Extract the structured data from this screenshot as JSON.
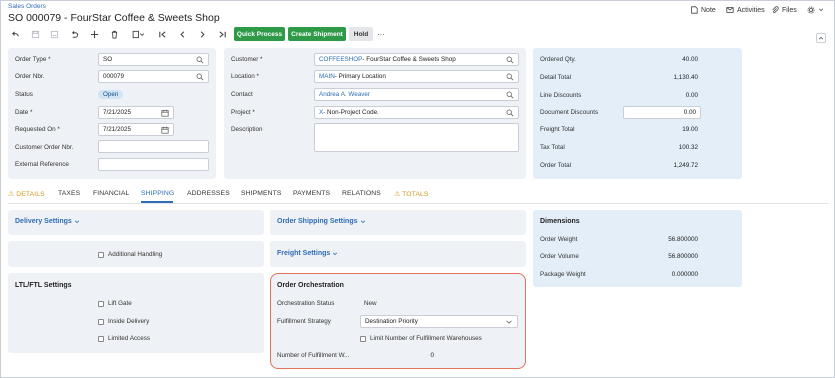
{
  "header": {
    "breadcrumb": "Sales Orders",
    "title": "SO 000079 - FourStar Coffee & Sweets Shop",
    "note_label": "Note",
    "activities_label": "Activities",
    "files_label": "Files"
  },
  "toolbar": {
    "quick_process": "Quick Process",
    "create_shipment": "Create Shipment",
    "hold": "Hold",
    "more": "···",
    "colors": {
      "green": "#2e9a47"
    }
  },
  "left_form": {
    "order_type_label": "Order Type *",
    "order_type_value": "SO",
    "order_nbr_label": "Order Nbr.",
    "order_nbr_value": "000079",
    "status_label": "Status",
    "status_value": "Open",
    "date_label": "Date *",
    "date_value": "7/21/2025",
    "requested_on_label": "Requested On *",
    "requested_on_value": "7/21/2025",
    "customer_order_label": "Customer Order Nbr.",
    "customer_order_value": "",
    "external_ref_label": "External Reference",
    "external_ref_value": ""
  },
  "mid_form": {
    "customer_label": "Customer *",
    "customer_code": "COFFEESHOP",
    "customer_name": " - FourStar Coffee & Sweets Shop",
    "location_label": "Location *",
    "location_code": "MAIN",
    "location_name": " - Primary Location",
    "contact_label": "Contact",
    "contact_value": "Andrea A. Weaver",
    "project_label": "Project *",
    "project_code": "X",
    "project_name": " - Non-Project Code.",
    "description_label": "Description",
    "description_value": ""
  },
  "totals": {
    "ordered_qty_label": "Ordered Qty.",
    "ordered_qty": "40.00",
    "detail_total_label": "Detail Total",
    "detail_total": "1,130.40",
    "line_discounts_label": "Line Discounts",
    "line_discounts": "0.00",
    "document_discounts_label": "Document Discounts",
    "document_discounts": "0.00",
    "freight_total_label": "Freight Total",
    "freight_total": "19.00",
    "tax_total_label": "Tax Total",
    "tax_total": "100.32",
    "order_total_label": "Order Total",
    "order_total": "1,249.72"
  },
  "tabs": {
    "details": "DETAILS",
    "taxes": "TAXES",
    "financial": "FINANCIAL",
    "shipping": "SHIPPING",
    "addresses": "ADDRESSES",
    "shipments": "SHIPMENTS",
    "payments": "PAYMENTS",
    "relations": "RELATIONS",
    "totals": "TOTALS",
    "active": "SHIPPING"
  },
  "shipping": {
    "delivery_settings": "Delivery Settings",
    "additional_handling": "Additional Handling",
    "ltl_title": "LTL/FTL Settings",
    "lift_gate": "Lift Gate",
    "inside_delivery": "Inside Delivery",
    "limited_access": "Limited Access",
    "order_shipping_settings": "Order Shipping Settings",
    "freight_settings": "Freight Settings",
    "orch_title": "Order Orchestration",
    "orch_status_label": "Orchestration Status",
    "orch_status_value": "New",
    "fulfillment_strategy_label": "Fulfillment Strategy",
    "fulfillment_strategy_value": "Destination Priority",
    "limit_warehouses": "Limit Number of Fulfillment Warehouses",
    "number_fulfillment_label": "Number of Fulfillment W...",
    "number_fulfillment_value": "0",
    "dimensions_title": "Dimensions",
    "order_weight_label": "Order Weight",
    "order_weight": "56.800000",
    "order_volume_label": "Order Volume",
    "order_volume": "56.800000",
    "package_weight_label": "Package Weight",
    "package_weight": "0.000000"
  }
}
